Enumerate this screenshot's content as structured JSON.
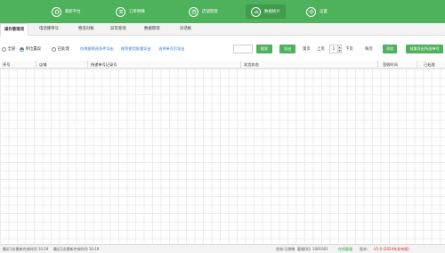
{
  "nav": {
    "items": [
      {
        "label": "最新平台",
        "icon": "home-icon"
      },
      {
        "label": "订单明细",
        "icon": "list-icon"
      },
      {
        "label": "店铺管理",
        "icon": "shop-icon"
      },
      {
        "label": "数据统计",
        "icon": "chart-icon"
      },
      {
        "label": "设置",
        "icon": "gear-icon"
      }
    ],
    "active_index": 3,
    "accent": "#4db25b"
  },
  "tabs": [
    {
      "label": "操作管理项"
    },
    {
      "label": "电话挪单号"
    },
    {
      "label": "物流对账"
    },
    {
      "label": "异常查询"
    },
    {
      "label": "数据管理"
    },
    {
      "label": "对话框"
    }
  ],
  "toolbar": {
    "radios": [
      {
        "label": "全部",
        "checked": false
      },
      {
        "label": "单位置段",
        "checked": true
      },
      {
        "label": "已处理",
        "checked": false
      }
    ],
    "hints": [
      "仅根据筛选条件导出",
      "推荐使用批量导出",
      "选择单号后导出"
    ],
    "search_placeholder": "",
    "search_button": "搜索",
    "export_button": "导出",
    "page_prefix": "第页",
    "page_label": "上页",
    "page_value": "1",
    "page_suffix": "下页",
    "total_label": "每页",
    "add_button": "添加",
    "batch_button": "批量导出所选单号"
  },
  "grid": {
    "columns": [
      "序号",
      "店铺",
      "快递单号记录号",
      "发货状态",
      "签收时间",
      "已处理"
    ]
  },
  "status": {
    "left1": "最近1次更新完成时间 10:19",
    "left2": "最近1次更新完成时间 10:19",
    "r1": "状态:已就绪",
    "r2": "客服QQ: 1001001",
    "r3": "在线客服",
    "r4": "版本:",
    "r5": "V1.0 (2024年发布版)"
  }
}
